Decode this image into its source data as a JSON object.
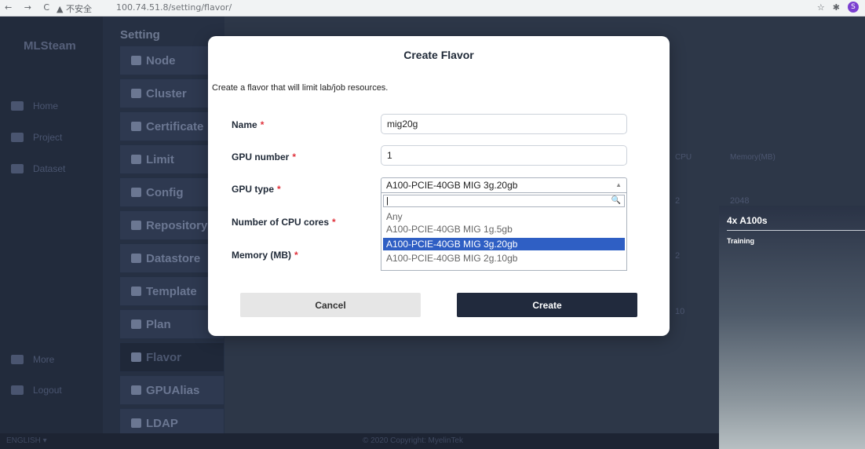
{
  "browser": {
    "nav_glyphs": "← → C",
    "security_text": "▲ 不安全",
    "url": "100.74.51.8/setting/flavor/"
  },
  "app": {
    "brand": "MLSteam",
    "nav": [
      "Home",
      "Project",
      "Dataset"
    ],
    "nav_bottom": [
      "More",
      "Logout"
    ],
    "setting_title": "Setting",
    "setting_items": [
      "Node",
      "Cluster",
      "Certificate",
      "Limit",
      "Config",
      "Repository",
      "Datastore",
      "Template",
      "Plan",
      "Flavor",
      "GPUAlias",
      "LDAP"
    ],
    "table_headers": [
      "CPU",
      "Memory(MB)"
    ],
    "table_cells": [
      "2",
      "2048",
      "2",
      "10"
    ],
    "footer_lang": "ENGLISH ▾",
    "footer_copy": "© 2020 Copyright: MyelinTek"
  },
  "modal": {
    "title": "Create Flavor",
    "description": "Create a flavor that will limit lab/job resources.",
    "fields": {
      "name": {
        "label": "Name",
        "value": "mig20g"
      },
      "gpu_number": {
        "label": "GPU number",
        "value": "1"
      },
      "gpu_type": {
        "label": "GPU type",
        "value": "A100-PCIE-40GB MIG 3g.20gb"
      },
      "cpu_cores": {
        "label": "Number of CPU cores"
      },
      "memory": {
        "label": "Memory (MB)"
      }
    },
    "required_mark": "*",
    "dropdown": {
      "search_value": "|",
      "options": [
        "Any",
        "A100-PCIE-40GB MIG 1g.5gb",
        "A100-PCIE-40GB MIG 3g.20gb",
        "A100-PCIE-40GB MIG 2g.10gb"
      ],
      "selected_index": 2
    },
    "cancel_label": "Cancel",
    "create_label": "Create"
  },
  "overlay_card": {
    "title": "4x A100s",
    "subtitle": "Training"
  },
  "colors": {
    "primary_button": "#212a3d",
    "selected_option": "#2f5fc4",
    "required": "#e0313b"
  }
}
